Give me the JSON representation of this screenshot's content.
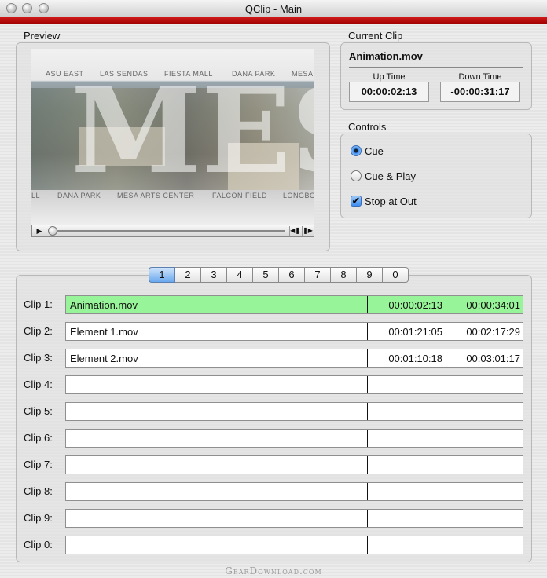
{
  "window": {
    "title": "QClip - Main"
  },
  "preview": {
    "label": "Preview",
    "video_overlay_top": [
      "ASU EAST",
      "LAS SENDAS",
      "FIESTA MALL",
      "DANA PARK",
      "MESA"
    ],
    "video_overlay_bottom": [
      "LL",
      "DANA PARK",
      "MESA ARTS CENTER",
      "FALCON FIELD",
      "LONGBO"
    ],
    "video_big_text": "MESA"
  },
  "current_clip": {
    "label": "Current Clip",
    "name": "Animation.mov",
    "up_time_label": "Up Time",
    "up_time": "00:00:02:13",
    "down_time_label": "Down Time",
    "down_time": "-00:00:31:17"
  },
  "controls": {
    "label": "Controls",
    "options": [
      {
        "label": "Cue",
        "selected": true
      },
      {
        "label": "Cue & Play",
        "selected": false
      }
    ],
    "stop_at_out": {
      "label": "Stop at Out",
      "checked": true
    }
  },
  "tabs": {
    "items": [
      "1",
      "2",
      "3",
      "4",
      "5",
      "6",
      "7",
      "8",
      "9",
      "0"
    ],
    "active": "1"
  },
  "clips": [
    {
      "label": "Clip 1:",
      "name": "Animation.mov",
      "in": "00:00:02:13",
      "out": "00:00:34:01",
      "active": true
    },
    {
      "label": "Clip 2:",
      "name": "Element 1.mov",
      "in": "00:01:21:05",
      "out": "00:02:17:29"
    },
    {
      "label": "Clip 3:",
      "name": "Element 2.mov",
      "in": "00:01:10:18",
      "out": "00:03:01:17"
    },
    {
      "label": "Clip 4:",
      "name": "",
      "in": "",
      "out": ""
    },
    {
      "label": "Clip 5:",
      "name": "",
      "in": "",
      "out": ""
    },
    {
      "label": "Clip 6:",
      "name": "",
      "in": "",
      "out": ""
    },
    {
      "label": "Clip 7:",
      "name": "",
      "in": "",
      "out": ""
    },
    {
      "label": "Clip 8:",
      "name": "",
      "in": "",
      "out": ""
    },
    {
      "label": "Clip 9:",
      "name": "",
      "in": "",
      "out": ""
    },
    {
      "label": "Clip 0:",
      "name": "",
      "in": "",
      "out": ""
    }
  ],
  "watermark": "GearDownload.com",
  "colors": {
    "accent_red": "#c00000",
    "active_row": "#98f498",
    "active_tab": "#6aa8ee"
  }
}
